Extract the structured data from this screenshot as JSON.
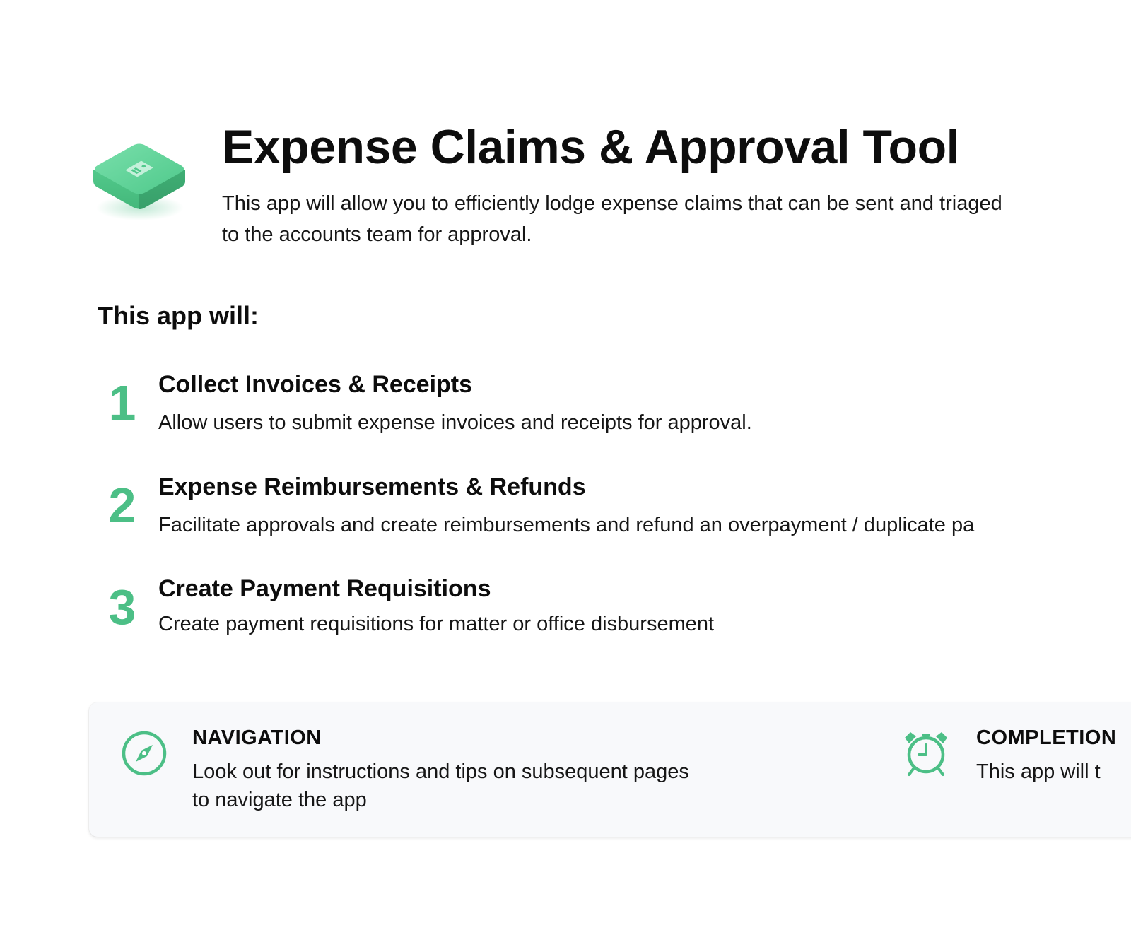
{
  "header": {
    "title": "Expense Claims & Approval Tool",
    "description": "This app will allow you to efficiently lodge expense claims that can be sent and triaged to the accounts team for approval.",
    "icon": "app-tile-icon"
  },
  "section": {
    "title": "This app will:"
  },
  "features": [
    {
      "number": "1",
      "title": "Collect Invoices & Receipts",
      "description": "Allow users to submit expense invoices and receipts for approval."
    },
    {
      "number": "2",
      "title": "Expense Reimbursements & Refunds",
      "description": "Facilitate approvals and create reimbursements and refund an overpayment / duplicate pa"
    },
    {
      "number": "3",
      "title": "Create Payment Requisitions",
      "description": "Create payment requisitions for matter or office disbursement"
    }
  ],
  "info": {
    "navigation": {
      "title": "NAVIGATION",
      "description": "Look out for instructions and tips on subsequent pages to navigate the app",
      "icon": "compass-icon"
    },
    "completion": {
      "title": "COMPLETION",
      "description": "This app will t",
      "icon": "alarm-clock-icon"
    }
  },
  "colors": {
    "accent": "#4cbf86",
    "panel_background": "#f8f9fb",
    "text": "#111111"
  }
}
